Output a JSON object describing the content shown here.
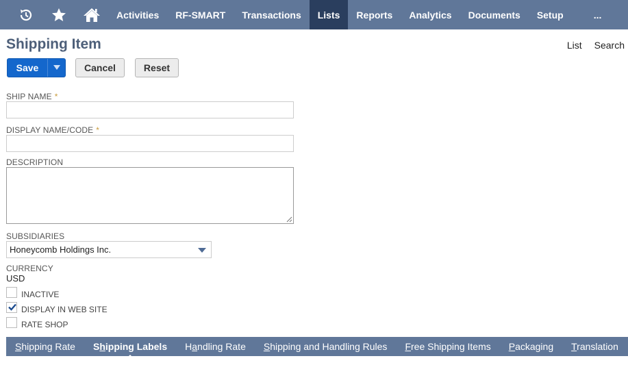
{
  "topnav": {
    "icons": [
      "recent-icon",
      "star-icon",
      "home-icon"
    ],
    "items": [
      {
        "label": "Activities",
        "active": false
      },
      {
        "label": "RF-SMART",
        "active": false
      },
      {
        "label": "Transactions",
        "active": false
      },
      {
        "label": "Lists",
        "active": true
      },
      {
        "label": "Reports",
        "active": false
      },
      {
        "label": "Analytics",
        "active": false
      },
      {
        "label": "Documents",
        "active": false
      },
      {
        "label": "Setup",
        "active": false
      }
    ],
    "more_label": "...",
    "bar_color": "#607799",
    "active_color": "#2a3e5e"
  },
  "page": {
    "title": "Shipping Item",
    "links": {
      "list": "List",
      "search": "Search"
    }
  },
  "buttons": {
    "save": "Save",
    "cancel": "Cancel",
    "reset": "Reset",
    "save_color": "#1467cc"
  },
  "form": {
    "ship_name": {
      "label": "SHIP NAME",
      "required_mark": "*",
      "value": ""
    },
    "display_name": {
      "label": "DISPLAY NAME/CODE",
      "required_mark": "*",
      "value": ""
    },
    "description": {
      "label": "DESCRIPTION",
      "value": ""
    },
    "subsidiaries": {
      "label": "SUBSIDIARIES",
      "selected": "Honeycomb Holdings Inc."
    },
    "currency": {
      "label": "CURRENCY",
      "value": "USD"
    },
    "checkboxes": [
      {
        "label": "INACTIVE",
        "checked": false
      },
      {
        "label": "DISPLAY IN WEB SITE",
        "checked": true
      },
      {
        "label": "RATE SHOP",
        "checked": false
      }
    ]
  },
  "subtabs": [
    {
      "label": "Shipping Rate",
      "active": false
    },
    {
      "label": "Shipping Labels",
      "active": true
    },
    {
      "label": "Handling Rate",
      "active": false
    },
    {
      "label": "Shipping and Handling Rules",
      "active": false
    },
    {
      "label": "Free Shipping Items",
      "active": false
    },
    {
      "label": "Packaging",
      "active": false
    },
    {
      "label": "Translation",
      "active": false
    }
  ]
}
